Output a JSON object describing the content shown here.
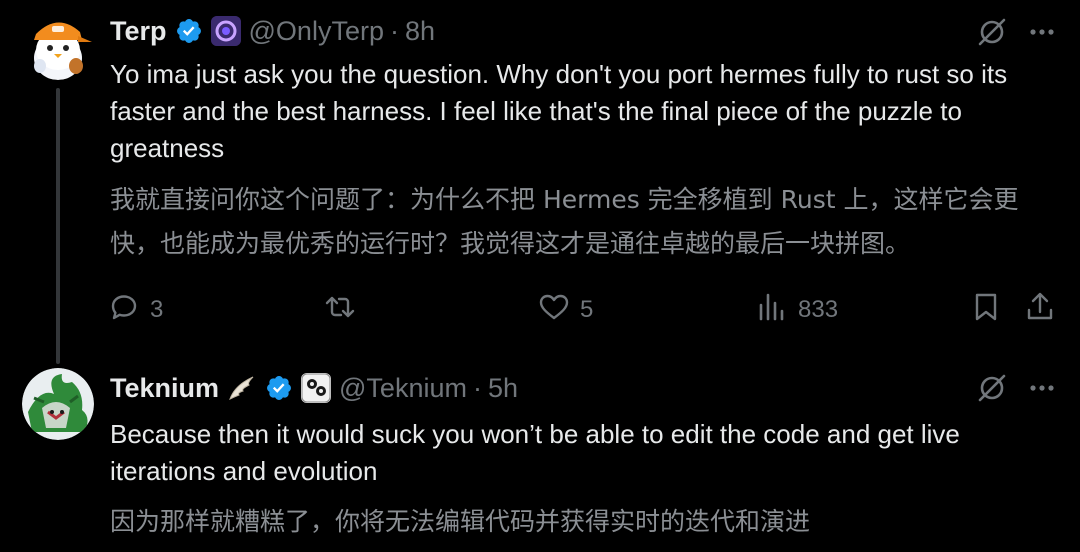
{
  "tweets": [
    {
      "author_name": "Terp",
      "handle": "@OnlyTerp",
      "separator": "·",
      "time": "8h",
      "text": "Yo ima just ask you the question. Why don't you port hermes fully to rust so its faster and the best harness. I feel like that's the final piece of the puzzle to greatness",
      "translation": "我就直接问你这个问题了：为什么不把 Hermes 完全移植到 Rust 上，这样它会更快，也能成为最优秀的运行时？我觉得这才是通往卓越的最后一块拼图。",
      "replies": "3",
      "retweets": "",
      "likes": "5",
      "views": "833",
      "icons": [
        "verified-badge-icon",
        "affiliate-badge-icon",
        "grok-icon",
        "more-icon",
        "reply-icon",
        "retweet-icon",
        "like-icon",
        "views-icon",
        "bookmark-icon",
        "share-icon"
      ]
    },
    {
      "author_name": "Teknium",
      "name_emoji": "wing-emoji",
      "handle": "@Teknium",
      "separator": "·",
      "time": "5h",
      "text": "Because then it would suck you won’t be able to edit the code and get live iterations and evolution",
      "translation": "因为那样就糟糕了，你将无法编辑代码并获得实时的迭代和演进",
      "icons": [
        "verified-badge-icon",
        "affiliate-badge-icon",
        "grok-icon",
        "more-icon"
      ]
    }
  ],
  "colors": {
    "background": "#000000",
    "text_primary": "#e7e9ea",
    "text_secondary": "#71767b",
    "verified_blue": "#1d9bf0",
    "thread_line": "#333639"
  }
}
